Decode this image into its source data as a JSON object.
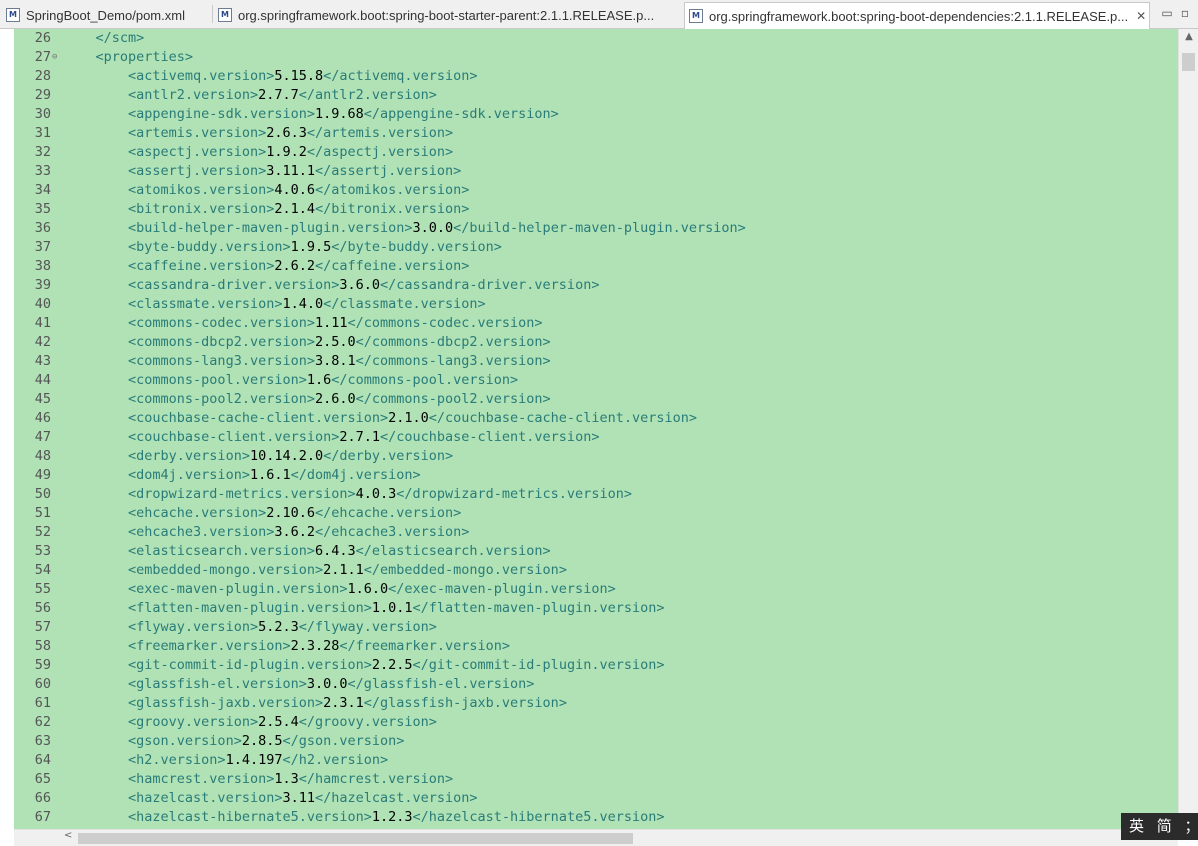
{
  "tabs": [
    {
      "icon": "M",
      "label": "SpringBoot_Demo/pom.xml"
    },
    {
      "icon": "M",
      "label": "org.springframework.boot:spring-boot-starter-parent:2.1.1.RELEASE.p..."
    },
    {
      "icon": "M",
      "label": "org.springframework.boot:spring-boot-dependencies:2.1.1.RELEASE.p...",
      "close": "✕"
    }
  ],
  "window_controls": {
    "minimize": "▭",
    "maximize": "▫"
  },
  "lines": [
    {
      "n": "26",
      "indent": "    ",
      "open": "</scm>",
      "value": "",
      "close": ""
    },
    {
      "n": "27",
      "indent": "    ",
      "open": "<properties>",
      "value": "",
      "close": "",
      "fold": "⊖"
    },
    {
      "n": "28",
      "indent": "        ",
      "open": "<activemq.version>",
      "value": "5.15.8",
      "close": "</activemq.version>"
    },
    {
      "n": "29",
      "indent": "        ",
      "open": "<antlr2.version>",
      "value": "2.7.7",
      "close": "</antlr2.version>"
    },
    {
      "n": "30",
      "indent": "        ",
      "open": "<appengine-sdk.version>",
      "value": "1.9.68",
      "close": "</appengine-sdk.version>"
    },
    {
      "n": "31",
      "indent": "        ",
      "open": "<artemis.version>",
      "value": "2.6.3",
      "close": "</artemis.version>"
    },
    {
      "n": "32",
      "indent": "        ",
      "open": "<aspectj.version>",
      "value": "1.9.2",
      "close": "</aspectj.version>"
    },
    {
      "n": "33",
      "indent": "        ",
      "open": "<assertj.version>",
      "value": "3.11.1",
      "close": "</assertj.version>"
    },
    {
      "n": "34",
      "indent": "        ",
      "open": "<atomikos.version>",
      "value": "4.0.6",
      "close": "</atomikos.version>"
    },
    {
      "n": "35",
      "indent": "        ",
      "open": "<bitronix.version>",
      "value": "2.1.4",
      "close": "</bitronix.version>"
    },
    {
      "n": "36",
      "indent": "        ",
      "open": "<build-helper-maven-plugin.version>",
      "value": "3.0.0",
      "close": "</build-helper-maven-plugin.version>"
    },
    {
      "n": "37",
      "indent": "        ",
      "open": "<byte-buddy.version>",
      "value": "1.9.5",
      "close": "</byte-buddy.version>"
    },
    {
      "n": "38",
      "indent": "        ",
      "open": "<caffeine.version>",
      "value": "2.6.2",
      "close": "</caffeine.version>"
    },
    {
      "n": "39",
      "indent": "        ",
      "open": "<cassandra-driver.version>",
      "value": "3.6.0",
      "close": "</cassandra-driver.version>"
    },
    {
      "n": "40",
      "indent": "        ",
      "open": "<classmate.version>",
      "value": "1.4.0",
      "close": "</classmate.version>"
    },
    {
      "n": "41",
      "indent": "        ",
      "open": "<commons-codec.version>",
      "value": "1.11",
      "close": "</commons-codec.version>"
    },
    {
      "n": "42",
      "indent": "        ",
      "open": "<commons-dbcp2.version>",
      "value": "2.5.0",
      "close": "</commons-dbcp2.version>"
    },
    {
      "n": "43",
      "indent": "        ",
      "open": "<commons-lang3.version>",
      "value": "3.8.1",
      "close": "</commons-lang3.version>"
    },
    {
      "n": "44",
      "indent": "        ",
      "open": "<commons-pool.version>",
      "value": "1.6",
      "close": "</commons-pool.version>"
    },
    {
      "n": "45",
      "indent": "        ",
      "open": "<commons-pool2.version>",
      "value": "2.6.0",
      "close": "</commons-pool2.version>"
    },
    {
      "n": "46",
      "indent": "        ",
      "open": "<couchbase-cache-client.version>",
      "value": "2.1.0",
      "close": "</couchbase-cache-client.version>"
    },
    {
      "n": "47",
      "indent": "        ",
      "open": "<couchbase-client.version>",
      "value": "2.7.1",
      "close": "</couchbase-client.version>"
    },
    {
      "n": "48",
      "indent": "        ",
      "open": "<derby.version>",
      "value": "10.14.2.0",
      "close": "</derby.version>"
    },
    {
      "n": "49",
      "indent": "        ",
      "open": "<dom4j.version>",
      "value": "1.6.1",
      "close": "</dom4j.version>"
    },
    {
      "n": "50",
      "indent": "        ",
      "open": "<dropwizard-metrics.version>",
      "value": "4.0.3",
      "close": "</dropwizard-metrics.version>"
    },
    {
      "n": "51",
      "indent": "        ",
      "open": "<ehcache.version>",
      "value": "2.10.6",
      "close": "</ehcache.version>"
    },
    {
      "n": "52",
      "indent": "        ",
      "open": "<ehcache3.version>",
      "value": "3.6.2",
      "close": "</ehcache3.version>"
    },
    {
      "n": "53",
      "indent": "        ",
      "open": "<elasticsearch.version>",
      "value": "6.4.3",
      "close": "</elasticsearch.version>"
    },
    {
      "n": "54",
      "indent": "        ",
      "open": "<embedded-mongo.version>",
      "value": "2.1.1",
      "close": "</embedded-mongo.version>"
    },
    {
      "n": "55",
      "indent": "        ",
      "open": "<exec-maven-plugin.version>",
      "value": "1.6.0",
      "close": "</exec-maven-plugin.version>"
    },
    {
      "n": "56",
      "indent": "        ",
      "open": "<flatten-maven-plugin.version>",
      "value": "1.0.1",
      "close": "</flatten-maven-plugin.version>"
    },
    {
      "n": "57",
      "indent": "        ",
      "open": "<flyway.version>",
      "value": "5.2.3",
      "close": "</flyway.version>"
    },
    {
      "n": "58",
      "indent": "        ",
      "open": "<freemarker.version>",
      "value": "2.3.28",
      "close": "</freemarker.version>"
    },
    {
      "n": "59",
      "indent": "        ",
      "open": "<git-commit-id-plugin.version>",
      "value": "2.2.5",
      "close": "</git-commit-id-plugin.version>"
    },
    {
      "n": "60",
      "indent": "        ",
      "open": "<glassfish-el.version>",
      "value": "3.0.0",
      "close": "</glassfish-el.version>"
    },
    {
      "n": "61",
      "indent": "        ",
      "open": "<glassfish-jaxb.version>",
      "value": "2.3.1",
      "close": "</glassfish-jaxb.version>"
    },
    {
      "n": "62",
      "indent": "        ",
      "open": "<groovy.version>",
      "value": "2.5.4",
      "close": "</groovy.version>"
    },
    {
      "n": "63",
      "indent": "        ",
      "open": "<gson.version>",
      "value": "2.8.5",
      "close": "</gson.version>"
    },
    {
      "n": "64",
      "indent": "        ",
      "open": "<h2.version>",
      "value": "1.4.197",
      "close": "</h2.version>"
    },
    {
      "n": "65",
      "indent": "        ",
      "open": "<hamcrest.version>",
      "value": "1.3",
      "close": "</hamcrest.version>"
    },
    {
      "n": "66",
      "indent": "        ",
      "open": "<hazelcast.version>",
      "value": "3.11",
      "close": "</hazelcast.version>"
    },
    {
      "n": "67",
      "indent": "        ",
      "open": "<hazelcast-hibernate5.version>",
      "value": "1.2.3",
      "close": "</hazelcast-hibernate5.version>"
    }
  ],
  "scroll_arrows": {
    "up": "▲",
    "left": "<",
    "right": ">"
  },
  "ime": {
    "text": "英 简 ；"
  }
}
